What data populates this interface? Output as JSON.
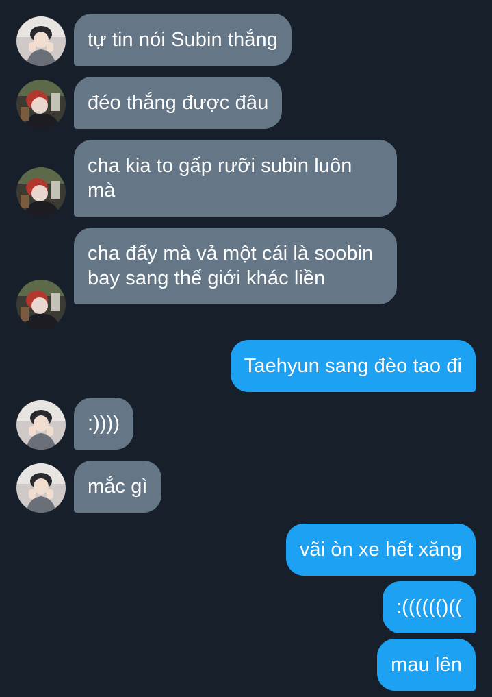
{
  "colors": {
    "background": "#17202a",
    "incoming_bubble": "#657786",
    "outgoing_bubble": "#1da1f2",
    "text": "#ffffff"
  },
  "messages": [
    {
      "side": "in",
      "avatar": "avatar-a",
      "text": "tự tin nói Subin thắng"
    },
    {
      "side": "in",
      "avatar": "avatar-b",
      "text": "đéo thắng được đâu"
    },
    {
      "side": "in",
      "avatar": "avatar-b",
      "text": "cha kia to gấp rưỡi subin luôn mà"
    },
    {
      "side": "in",
      "avatar": "avatar-b",
      "text": "cha đấy mà vả một cái là soobin bay sang thế giới khác liền"
    },
    {
      "side": "out",
      "text": "Taehyun sang đèo tao đi"
    },
    {
      "side": "in",
      "avatar": "avatar-a",
      "text": ":))))"
    },
    {
      "side": "in",
      "avatar": "avatar-a",
      "text": "mắc gì"
    },
    {
      "side": "out",
      "text": "vãi òn xe hết xăng"
    },
    {
      "side": "out",
      "text": ":(((((()(("
    },
    {
      "side": "out",
      "text": "mau lên"
    }
  ]
}
